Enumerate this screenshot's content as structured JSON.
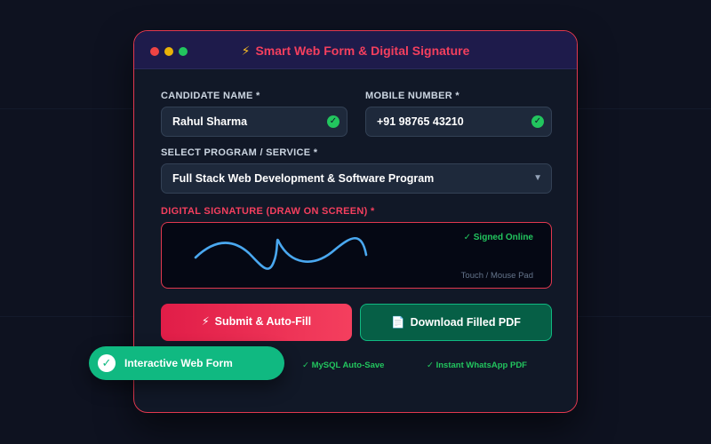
{
  "window": {
    "title": "Smart Web Form & Digital Signature",
    "title_icon": "⚡",
    "controls": [
      "close",
      "minimize",
      "maximize"
    ]
  },
  "form": {
    "name_label": "CANDIDATE NAME *",
    "name_value": "Rahul Sharma",
    "mobile_label": "MOBILE NUMBER *",
    "mobile_value": "+91 98765 43210",
    "program_label": "SELECT PROGRAM / SERVICE *",
    "program_value": "Full Stack Web Development & Software Program",
    "signature_label": "DIGITAL SIGNATURE (DRAW ON SCREEN) *",
    "signature_status": "✓ Signed Online",
    "signature_hint": "Touch / Mouse Pad"
  },
  "buttons": {
    "submit_icon": "⚡",
    "submit_label": "Submit & Auto-Fill",
    "download_icon": "📄",
    "download_label": "Download Filled PDF"
  },
  "features": [
    "✓ MySQL Auto-Save",
    "✓ Instant WhatsApp PDF"
  ],
  "toast": {
    "icon": "✓",
    "label": "Interactive Web Form"
  },
  "colors": {
    "accent": "#f43f5e",
    "success": "#22c55e",
    "signature_stroke": "#4aa8f0"
  }
}
